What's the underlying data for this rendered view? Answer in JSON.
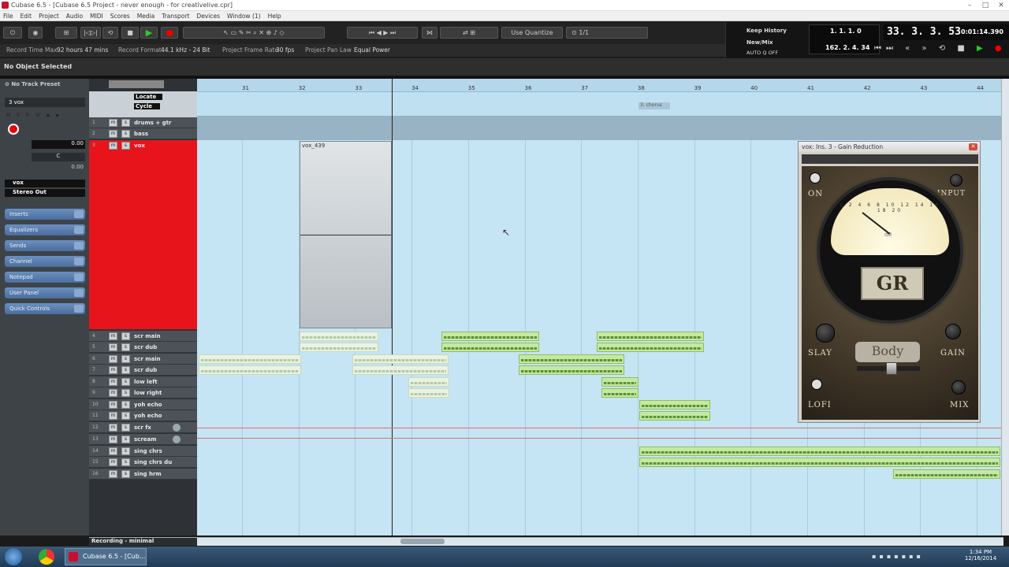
{
  "window": {
    "title": "Cubase 6.5 - [Cubase 6.5 Project - never enough - for creativelive.cpr]"
  },
  "menu": [
    "File",
    "Edit",
    "Project",
    "Audio",
    "MIDI",
    "Scores",
    "Media",
    "Transport",
    "Devices",
    "Window (1)",
    "Help"
  ],
  "toolbar": {
    "quantize": "Use Quantize",
    "fraction": "1/1"
  },
  "info_bar": {
    "record_time_max_label": "Record Time Max",
    "record_time_max": "92 hours 47 mins",
    "record_format_label": "Record Format",
    "record_format": "44.1 kHz - 24 Bit",
    "frame_rate_label": "Project Frame Rate",
    "frame_rate": "30 fps",
    "pan_law_label": "Project Pan Law",
    "pan_law": "Equal Power"
  },
  "object_selection": "No Object Selected",
  "transport": {
    "keep_history": "Keep History",
    "new_mix": "New/Mix",
    "auto_q": "AUTO Q",
    "off": "OFF",
    "left_locator": "1. 1. 1. 0",
    "right_locator": "162. 2. 4. 34",
    "position": "33. 3. 3. 53",
    "time": "0:01:14.390"
  },
  "inspector": {
    "track_preset": "No Track Preset",
    "track_name": "3 vox",
    "volume": "0.00",
    "pan": "C",
    "delay": "0.00",
    "input": "vox",
    "output": "Stereo Out",
    "sections": [
      "Inserts",
      "Equalizers",
      "Sends",
      "Channel",
      "Notepad",
      "User Panel",
      "Quick Controls"
    ]
  },
  "track_header_top": {
    "locate": "Locate",
    "cycle": "Cycle"
  },
  "tracks": [
    {
      "num": "1",
      "name": "drums + gtr"
    },
    {
      "num": "2",
      "name": "bass"
    },
    {
      "num": "3",
      "name": "vox"
    },
    {
      "num": "4",
      "name": "scr main"
    },
    {
      "num": "5",
      "name": "scr dub"
    },
    {
      "num": "6",
      "name": "scr main"
    },
    {
      "num": "7",
      "name": "scr dub"
    },
    {
      "num": "8",
      "name": "low left"
    },
    {
      "num": "9",
      "name": "low right"
    },
    {
      "num": "10",
      "name": "yoh echo"
    },
    {
      "num": "11",
      "name": "yoh echo"
    },
    {
      "num": "12",
      "name": "scr fx"
    },
    {
      "num": "13",
      "name": "scream"
    },
    {
      "num": "14",
      "name": "sing chrs"
    },
    {
      "num": "15",
      "name": "sing chrs du"
    },
    {
      "num": "16",
      "name": "sing hrm"
    }
  ],
  "ruler": {
    "bars": [
      "31",
      "32",
      "33",
      "34",
      "35",
      "36",
      "37",
      "38",
      "39",
      "40",
      "41",
      "42",
      "43",
      "44"
    ],
    "marker": "3: chorus"
  },
  "event": {
    "vox_label": "vox_439"
  },
  "plugin": {
    "title": "vox: Ins. 3 - Gain Reduction",
    "badge": "GR",
    "on": "ON",
    "input": "INPUT",
    "slay": "SLAY",
    "gain": "GAIN",
    "body": "Body",
    "lofi": "LOFI",
    "mix": "MIX",
    "db": "dB",
    "scale": [
      "1",
      "2",
      "4",
      "6",
      "8",
      "10",
      "12",
      "14",
      "16",
      "18",
      "20"
    ]
  },
  "status": {
    "workspace": "Recording - minimal"
  },
  "taskbar": {
    "app": "Cubase 6.5 - [Cub...",
    "time": "1:34 PM",
    "date": "12/16/2014"
  },
  "colors": {
    "arrange_bg": "#c5e4f4",
    "selected_track": "#e8141c",
    "event_green": "#c5e9a0"
  }
}
